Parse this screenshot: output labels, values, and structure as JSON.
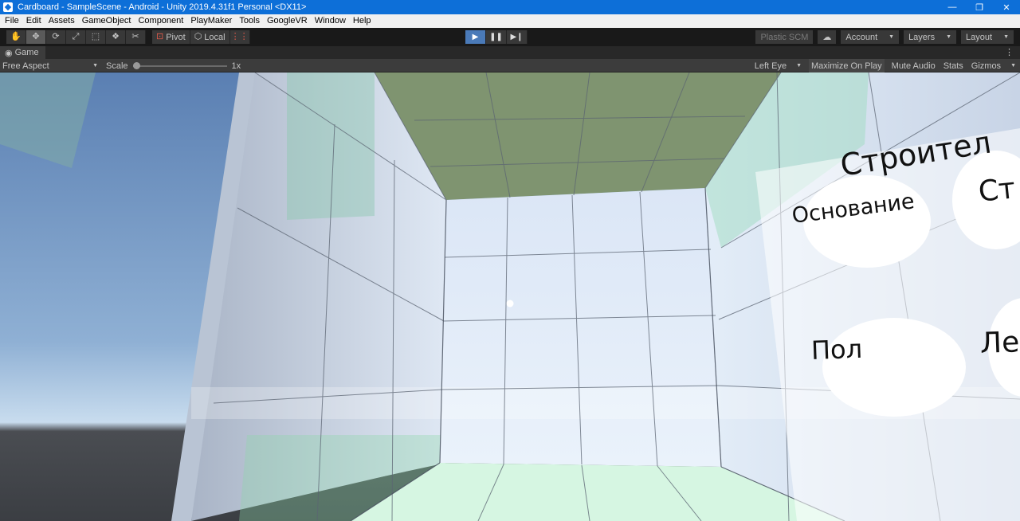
{
  "window": {
    "title": "Cardboard - SampleScene - Android - Unity 2019.4.31f1 Personal <DX11>",
    "minimize_glyph": "—",
    "maximize_glyph": "❐",
    "close_glyph": "✕"
  },
  "menu": [
    "File",
    "Edit",
    "Assets",
    "GameObject",
    "Component",
    "PlayMaker",
    "Tools",
    "GoogleVR",
    "Window",
    "Help"
  ],
  "toolbar": {
    "tools": [
      {
        "name": "hand-tool-icon",
        "glyph": "✋"
      },
      {
        "name": "move-tool-icon",
        "glyph": "✥"
      },
      {
        "name": "rotate-tool-icon",
        "glyph": "⟳"
      },
      {
        "name": "scale-tool-icon",
        "glyph": "⤢"
      },
      {
        "name": "rect-tool-icon",
        "glyph": "⬚"
      },
      {
        "name": "transform-tool-icon",
        "glyph": "❖"
      },
      {
        "name": "custom-tool-icon",
        "glyph": "✂"
      }
    ],
    "pivot_label": "Pivot",
    "local_label": "Local",
    "snap_glyph": "⋮⋮",
    "play_glyph": "▶",
    "pause_glyph": "❚❚",
    "step_glyph": "▶❙",
    "plastic_scm_label": "Plastic SCM",
    "cloud_glyph": "☁",
    "account_label": "Account",
    "layers_label": "Layers",
    "layout_label": "Layout",
    "caret": "▼"
  },
  "game_tab": {
    "label": "Game",
    "icon_glyph": "◉",
    "menu_glyph": "⋮"
  },
  "game_controls": {
    "aspect": "Free Aspect",
    "scale_label": "Scale",
    "scale_value": "1x",
    "scale_level": 0,
    "eye": "Left Eye",
    "maximize_on_play": "Maximize On Play",
    "mute_audio": "Mute Audio",
    "stats": "Stats",
    "gizmos": "Gizmos",
    "caret": "▼"
  },
  "scene": {
    "panel_title": "Строител",
    "button_foundation": "Основание",
    "button_partial_top": "Ст",
    "button_floor": "Пол",
    "button_partial_bottom": "Ле",
    "colors": {
      "sky": "#6e8fb8",
      "ceiling": "#7a9068",
      "wall": "#c8d6ea",
      "floor": "#cfeedd",
      "grid": "#5b6472"
    }
  }
}
